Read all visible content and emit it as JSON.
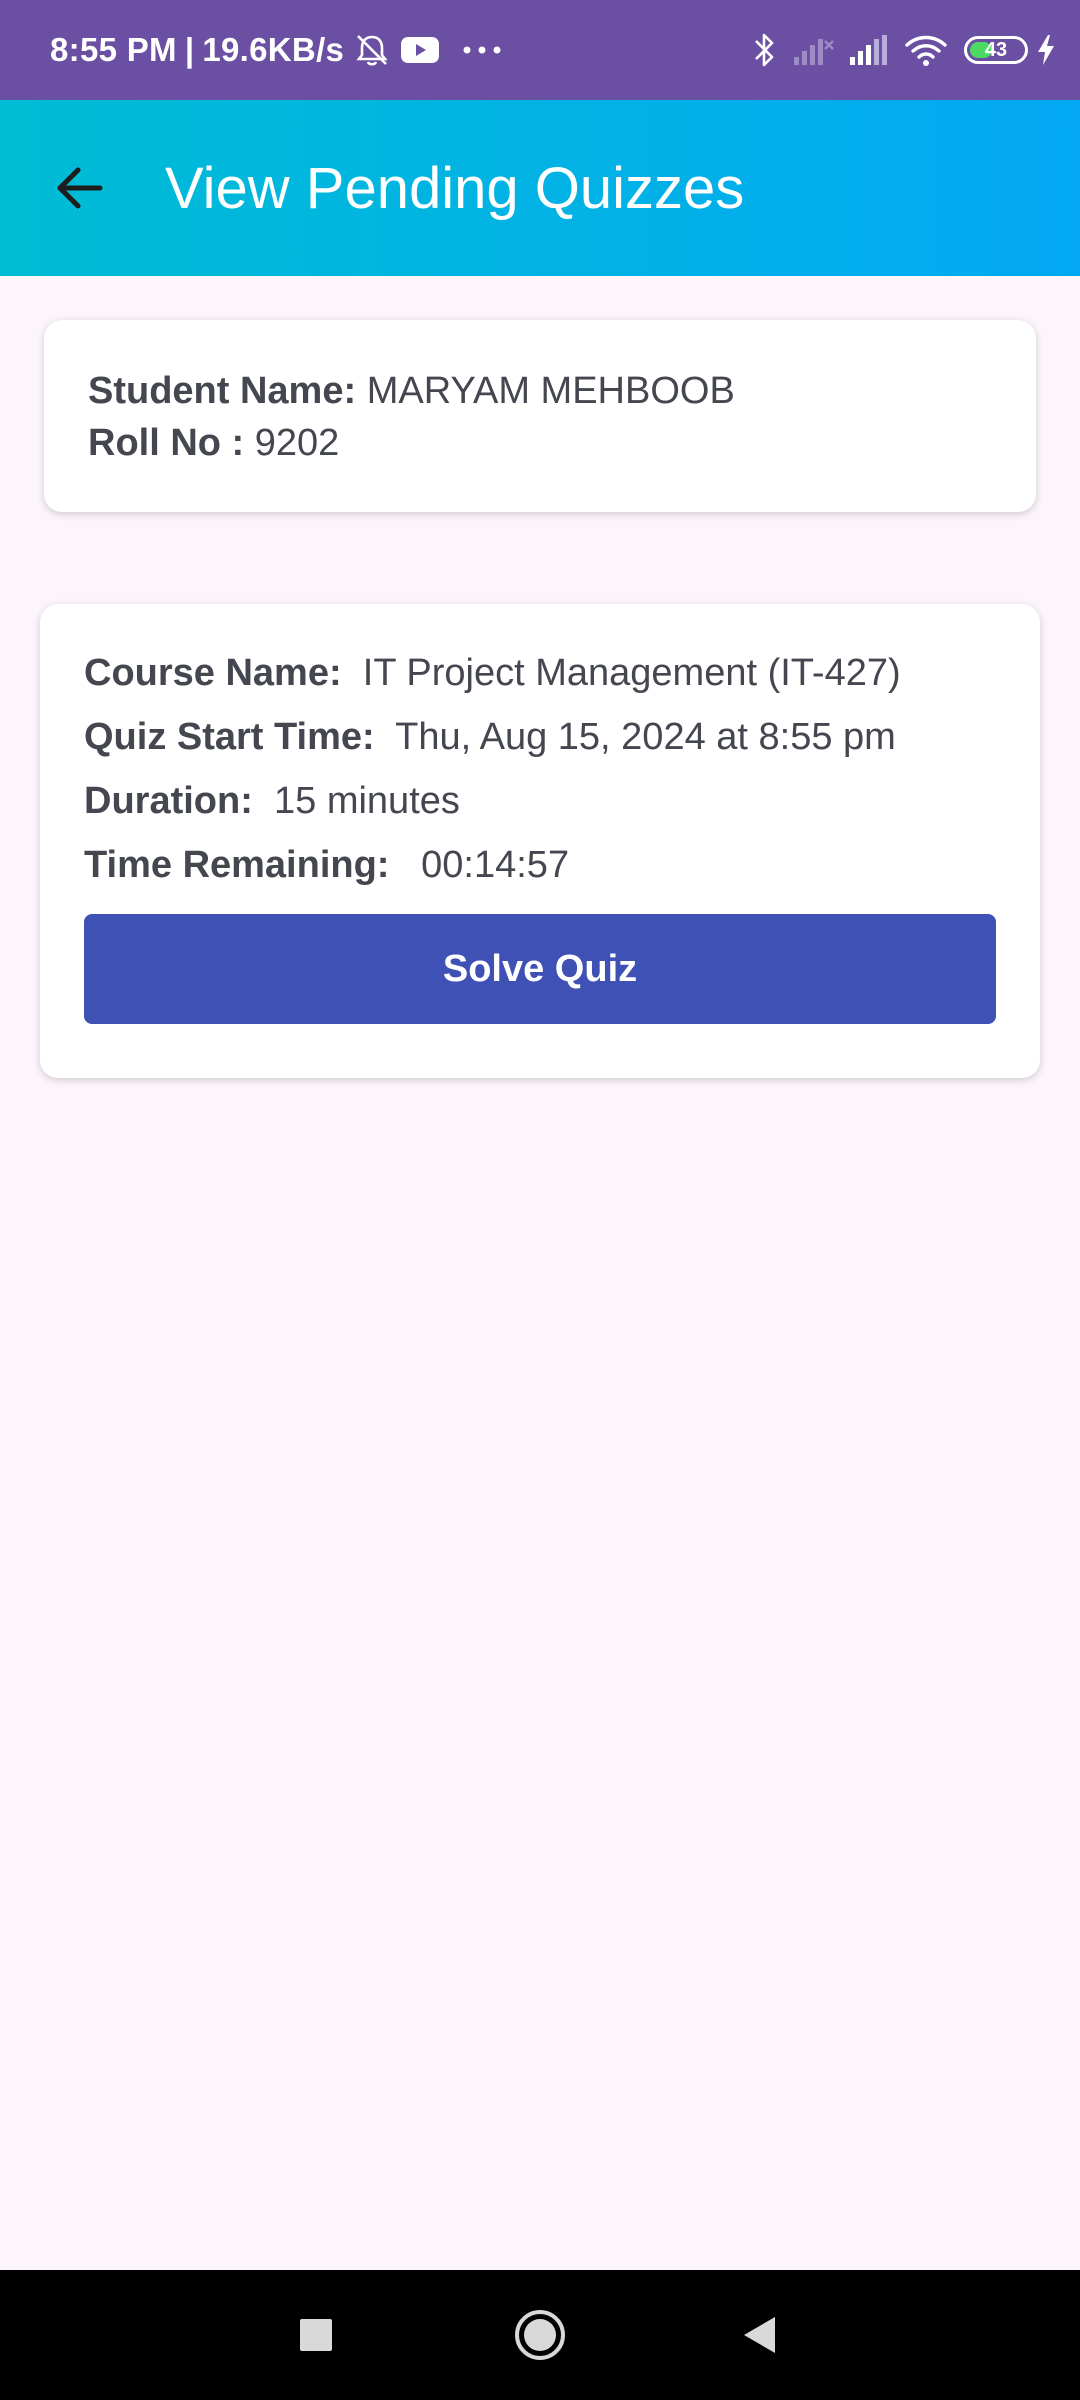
{
  "status_bar": {
    "time": "8:55 PM",
    "separator": "|",
    "network_speed": "19.6KB/s",
    "battery_level": "43",
    "battery_fraction": 0.43,
    "icons_left": [
      "muted-alarm-icon",
      "youtube-icon",
      "more-dots-icon"
    ],
    "icons_right": [
      "bluetooth-icon",
      "signal-weak-icon",
      "signal-icon",
      "wifi-icon",
      "battery-icon",
      "charging-icon"
    ]
  },
  "app_bar": {
    "title": "View Pending Quizzes",
    "background_start": "#00bcd4",
    "background_end": "#03a9f4",
    "back_icon": "arrow-back-icon"
  },
  "student": {
    "name_label": "Student Name:",
    "name_value": "MARYAM MEHBOOB",
    "roll_label": "Roll No :",
    "roll_value": "9202"
  },
  "quiz": {
    "course_label": "Course Name:",
    "course_value": "IT Project Management (IT-427)",
    "start_label": "Quiz Start Time:",
    "start_value": "Thu, Aug 15, 2024 at 8:55 pm",
    "duration_label": "Duration:",
    "duration_value": "15 minutes",
    "remaining_label": "Time Remaining:",
    "remaining_value": "00:14:57",
    "solve_label": "Solve Quiz",
    "button_color": "#3f51b5"
  },
  "nav_bar": {
    "icons": [
      "recents-square-icon",
      "home-circle-icon",
      "back-triangle-icon"
    ]
  }
}
